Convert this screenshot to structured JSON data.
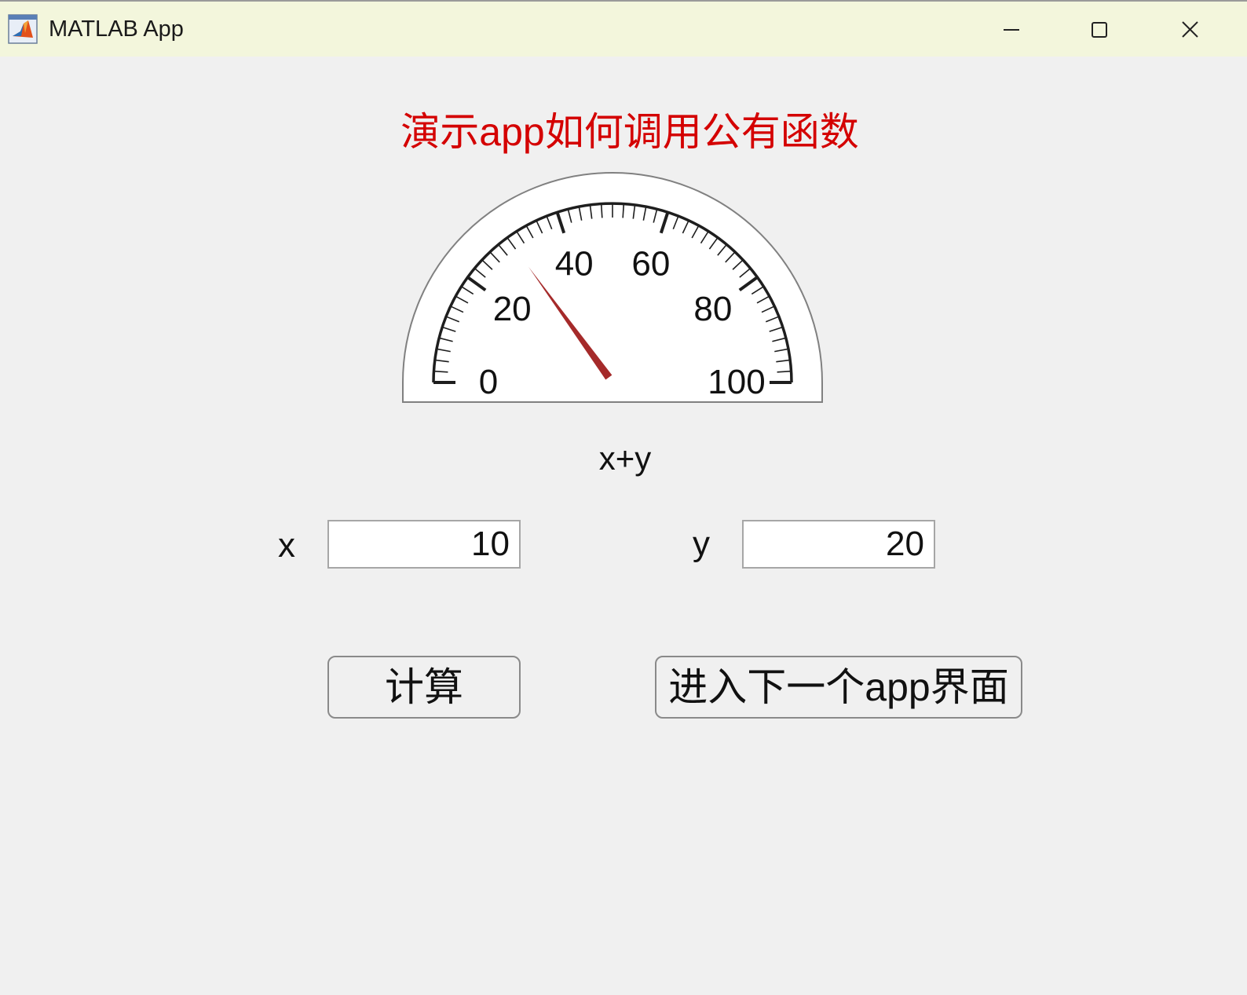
{
  "window": {
    "title": "MATLAB App"
  },
  "heading": "演示app如何调用公有函数",
  "gauge": {
    "min": 0,
    "max": 100,
    "value": 30,
    "tick_labels": [
      "0",
      "20",
      "40",
      "60",
      "80",
      "100"
    ],
    "label": "x+y",
    "needle_color": "#a52a2a"
  },
  "fields": {
    "x": {
      "label": "x",
      "value": "10"
    },
    "y": {
      "label": "y",
      "value": "20"
    }
  },
  "buttons": {
    "calculate": "计算",
    "next": "进入下一个app界面"
  },
  "colors": {
    "heading": "#d40000",
    "titlebar": "#f3f6dc",
    "background": "#f0f0f0"
  }
}
